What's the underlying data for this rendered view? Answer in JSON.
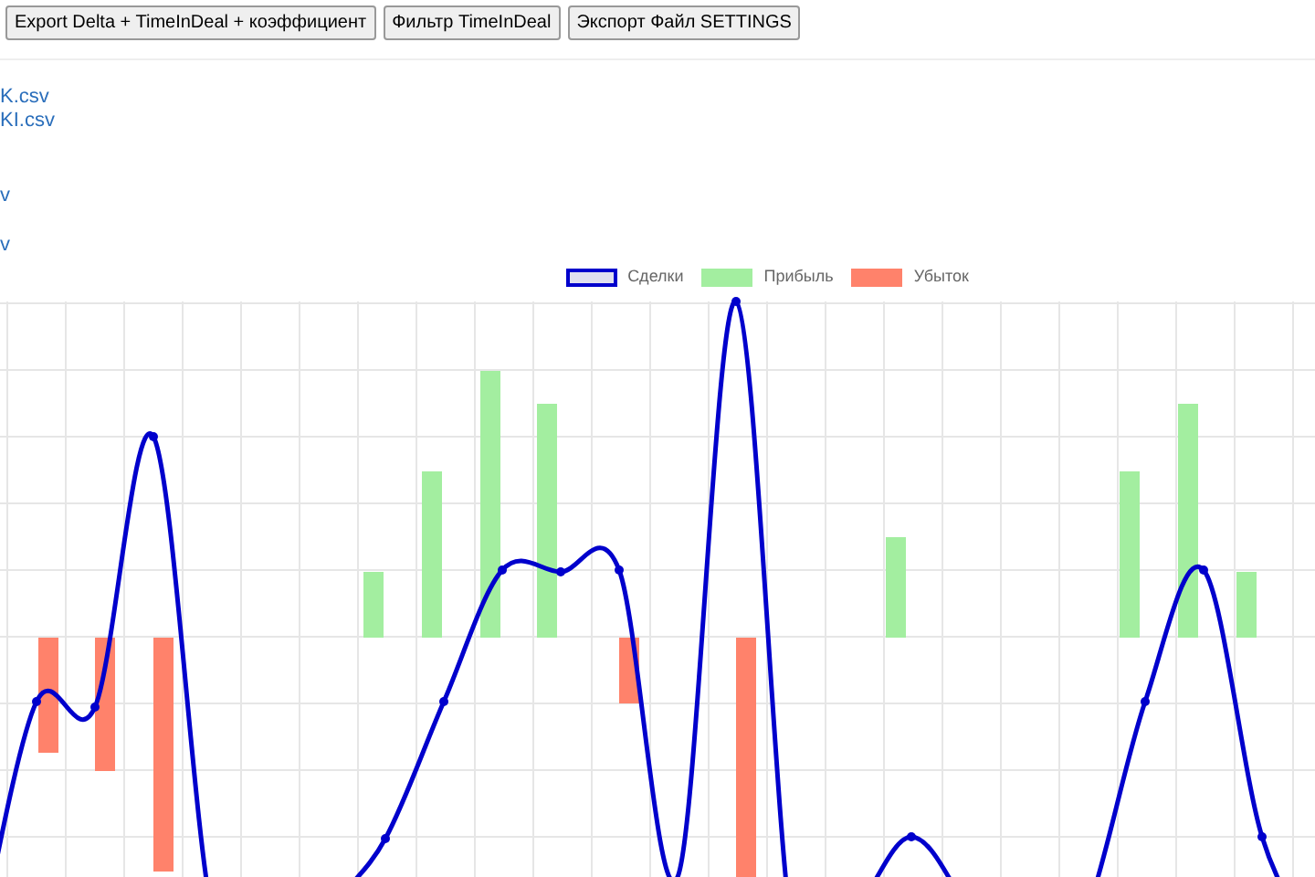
{
  "toolbar": {
    "buttons": [
      "Export Delta + TimeInDeal + коэффициент",
      "Фильтр TimeInDeal",
      "Экспорт Файл SETTINGS"
    ]
  },
  "file_links": [
    "K.csv",
    "KI.csv",
    "v",
    "v"
  ],
  "chart": {
    "legend": [
      {
        "label": "Сделки",
        "kind": "line",
        "color": "#0000cc"
      },
      {
        "label": "Прибыль",
        "kind": "bar",
        "color": "#a3eea0"
      },
      {
        "label": "Убыток",
        "kind": "bar",
        "color": "#ff826b"
      }
    ]
  }
}
